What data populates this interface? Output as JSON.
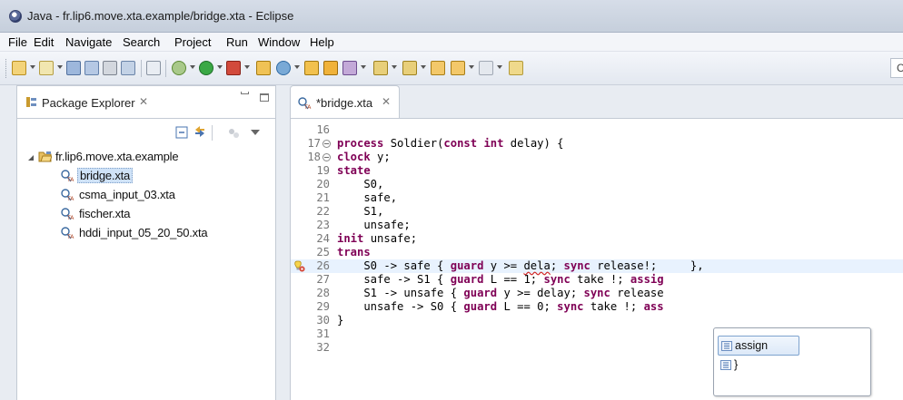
{
  "window": {
    "title": "Java - fr.lip6.move.xta.example/bridge.xta - Eclipse"
  },
  "menu": {
    "items": [
      "File",
      "Edit",
      "Navigate",
      "Search",
      "Project",
      "Run",
      "Window",
      "Help"
    ]
  },
  "toolbar": {
    "quick_access_text": "C"
  },
  "package_explorer": {
    "tab_label": "Package Explorer",
    "tab_close": "✕",
    "project": "fr.lip6.move.xta.example",
    "files": [
      "bridge.xta",
      "csma_input_03.xta",
      "fischer.xta",
      "hddi_input_05_20_50.xta"
    ],
    "selected_file": "bridge.xta"
  },
  "editor": {
    "tab_label": "*bridge.xta",
    "tab_close": "✕",
    "current_line": 26,
    "lines": [
      {
        "num": "16",
        "segs": []
      },
      {
        "num": "17",
        "fold": true,
        "segs": [
          {
            "k": true,
            "t": "process"
          },
          {
            "t": " Soldier("
          },
          {
            "k": true,
            "t": "const int"
          },
          {
            "t": " delay) {"
          }
        ]
      },
      {
        "num": "18",
        "fold": true,
        "segs": [
          {
            "k": true,
            "t": "clock"
          },
          {
            "t": " y;"
          }
        ]
      },
      {
        "num": "19",
        "segs": [
          {
            "k": true,
            "t": "state"
          }
        ]
      },
      {
        "num": "20",
        "segs": [
          {
            "t": "    S0,"
          }
        ]
      },
      {
        "num": "21",
        "segs": [
          {
            "t": "    safe,"
          }
        ]
      },
      {
        "num": "22",
        "segs": [
          {
            "t": "    S1,"
          }
        ]
      },
      {
        "num": "23",
        "segs": [
          {
            "t": "    unsafe;"
          }
        ]
      },
      {
        "num": "24",
        "segs": [
          {
            "k": true,
            "t": "init"
          },
          {
            "t": " unsafe;"
          }
        ]
      },
      {
        "num": "25",
        "segs": [
          {
            "k": true,
            "t": "trans"
          }
        ]
      },
      {
        "num": "26",
        "marker": true,
        "segs": [
          {
            "t": "    S0 -> safe { "
          },
          {
            "k": true,
            "t": "guard"
          },
          {
            "t": " y >= "
          },
          {
            "e": true,
            "t": "dela"
          },
          {
            "t": "; "
          },
          {
            "k": true,
            "t": "sync"
          },
          {
            "t": " release!;     },"
          }
        ]
      },
      {
        "num": "27",
        "segs": [
          {
            "t": "    safe -> S1 { "
          },
          {
            "k": true,
            "t": "guard"
          },
          {
            "t": " L == 1; "
          },
          {
            "k": true,
            "t": "sync"
          },
          {
            "t": " take !; "
          },
          {
            "k": true,
            "t": "assig"
          }
        ]
      },
      {
        "num": "28",
        "segs": [
          {
            "t": "    S1 -> unsafe { "
          },
          {
            "k": true,
            "t": "guard"
          },
          {
            "t": " y >= delay; "
          },
          {
            "k": true,
            "t": "sync"
          },
          {
            "t": " release"
          }
        ]
      },
      {
        "num": "29",
        "segs": [
          {
            "t": "    unsafe -> S0 { "
          },
          {
            "k": true,
            "t": "guard"
          },
          {
            "t": " L == 0; "
          },
          {
            "k": true,
            "t": "sync"
          },
          {
            "t": " take !; "
          },
          {
            "k": true,
            "t": "ass"
          }
        ]
      },
      {
        "num": "30",
        "segs": [
          {
            "t": "}"
          }
        ]
      },
      {
        "num": "31",
        "segs": []
      },
      {
        "num": "32",
        "segs": []
      }
    ]
  },
  "content_assist": {
    "proposals": [
      "assign",
      "}"
    ],
    "selected": "assign"
  },
  "colors": {
    "keyword": "#7f0055",
    "line_number": "#787878",
    "current_line_bg": "#e8f2fe",
    "error_underline": "#d02a2a"
  }
}
